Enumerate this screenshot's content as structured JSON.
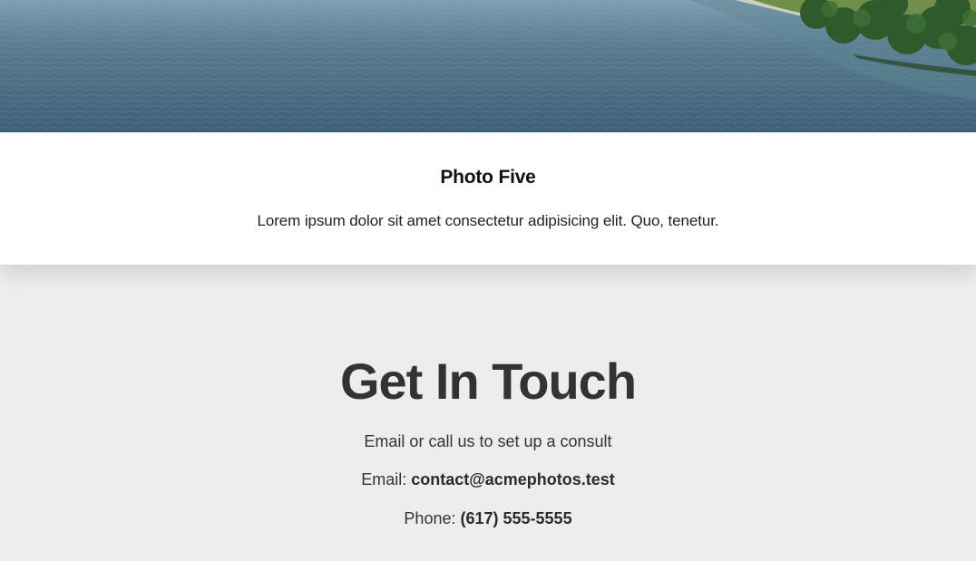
{
  "photo": {
    "image_alt": "water and shoreline with trees",
    "title": "Photo Five",
    "description": "Lorem ipsum dolor sit amet consectetur adipisicing elit. Quo, tenetur."
  },
  "contact": {
    "heading": "Get In Touch",
    "intro": "Email or call us to set up a consult",
    "email_label": "Email: ",
    "email_value": "contact@acmephotos.test",
    "phone_label": "Phone: ",
    "phone_value": "(617) 555-5555"
  },
  "colors": {
    "card_background": "#ffffff",
    "section_background": "#ededed",
    "heading_text": "#333333",
    "water": "#4f7389",
    "foliage": "#2f5a2c"
  }
}
